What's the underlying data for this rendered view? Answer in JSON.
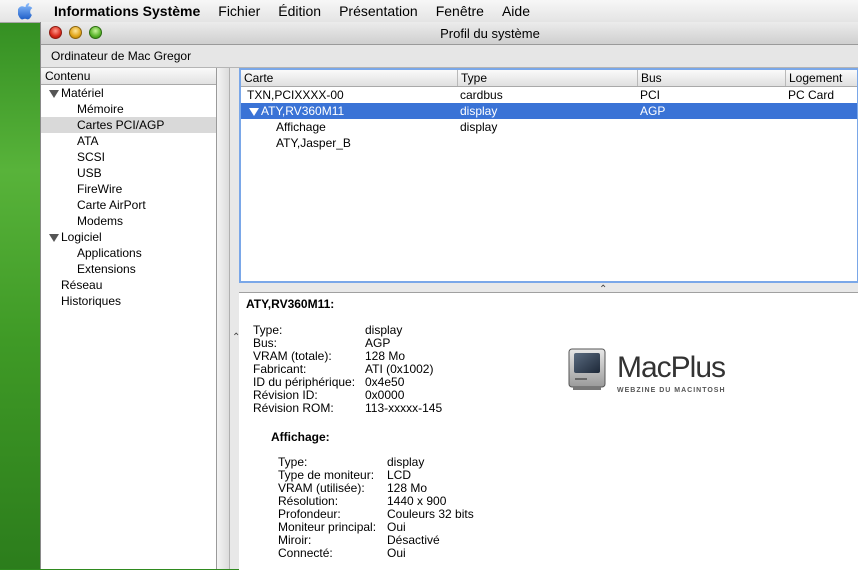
{
  "menubar": {
    "app_name": "Informations Système",
    "items": [
      "Fichier",
      "Édition",
      "Présentation",
      "Fenêtre",
      "Aide"
    ]
  },
  "window": {
    "title": "Profil du système",
    "computer_name": "Ordinateur de Mac Gregor"
  },
  "sidebar": {
    "header": "Contenu",
    "items": [
      {
        "label": "Matériel",
        "level": 0,
        "expanded": true
      },
      {
        "label": "Mémoire",
        "level": 1
      },
      {
        "label": "Cartes PCI/AGP",
        "level": 1,
        "selected": true
      },
      {
        "label": "ATA",
        "level": 1
      },
      {
        "label": "SCSI",
        "level": 1
      },
      {
        "label": "USB",
        "level": 1
      },
      {
        "label": "FireWire",
        "level": 1
      },
      {
        "label": "Carte AirPort",
        "level": 1
      },
      {
        "label": "Modems",
        "level": 1
      },
      {
        "label": "Logiciel",
        "level": 0,
        "expanded": true
      },
      {
        "label": "Applications",
        "level": 1
      },
      {
        "label": "Extensions",
        "level": 1
      },
      {
        "label": "Réseau",
        "level": 0
      },
      {
        "label": "Historiques",
        "level": 0
      }
    ]
  },
  "table": {
    "columns": [
      "Carte",
      "Type",
      "Bus",
      "Logement"
    ],
    "rows": [
      {
        "carte": "TXN,PCIXXXX-00",
        "type": "cardbus",
        "bus": "PCI",
        "logement": "PC Card"
      },
      {
        "carte": "ATY,RV360M11",
        "type": "display",
        "bus": "AGP",
        "logement": "",
        "selected": true,
        "expanded": true
      },
      {
        "carte": "Affichage",
        "type": "display",
        "bus": "",
        "logement": ""
      },
      {
        "carte": "ATY,Jasper_B",
        "type": "",
        "bus": "",
        "logement": ""
      }
    ]
  },
  "detail": {
    "title": "ATY,RV360M11:",
    "props": [
      {
        "key": "Type:",
        "value": "display"
      },
      {
        "key": "Bus:",
        "value": "AGP"
      },
      {
        "key": "VRAM (totale):",
        "value": "128 Mo"
      },
      {
        "key": "Fabricant:",
        "value": "ATI (0x1002)"
      },
      {
        "key": "ID du périphérique:",
        "value": "0x4e50"
      },
      {
        "key": "Révision ID:",
        "value": "0x0000"
      },
      {
        "key": "Révision ROM:",
        "value": "113-xxxxx-145"
      }
    ],
    "sub_title": "Affichage:",
    "sub_props": [
      {
        "key": "Type:",
        "value": "display"
      },
      {
        "key": "Type de moniteur:",
        "value": "LCD"
      },
      {
        "key": "VRAM (utilisée):",
        "value": "128 Mo"
      },
      {
        "key": "Résolution:",
        "value": "1440 x 900"
      },
      {
        "key": "Profondeur:",
        "value": "Couleurs 32 bits"
      },
      {
        "key": "Moniteur principal:",
        "value": "Oui"
      },
      {
        "key": "Miroir:",
        "value": "Désactivé"
      },
      {
        "key": "Connecté:",
        "value": "Oui"
      }
    ]
  },
  "logo": {
    "name": "MacPlus",
    "tagline": "WEBZINE DU MACINTOSH"
  },
  "colors": {
    "selection": "#3a73d6",
    "focus_ring": "#7aa7e8",
    "desktop": "#3f9a26"
  }
}
